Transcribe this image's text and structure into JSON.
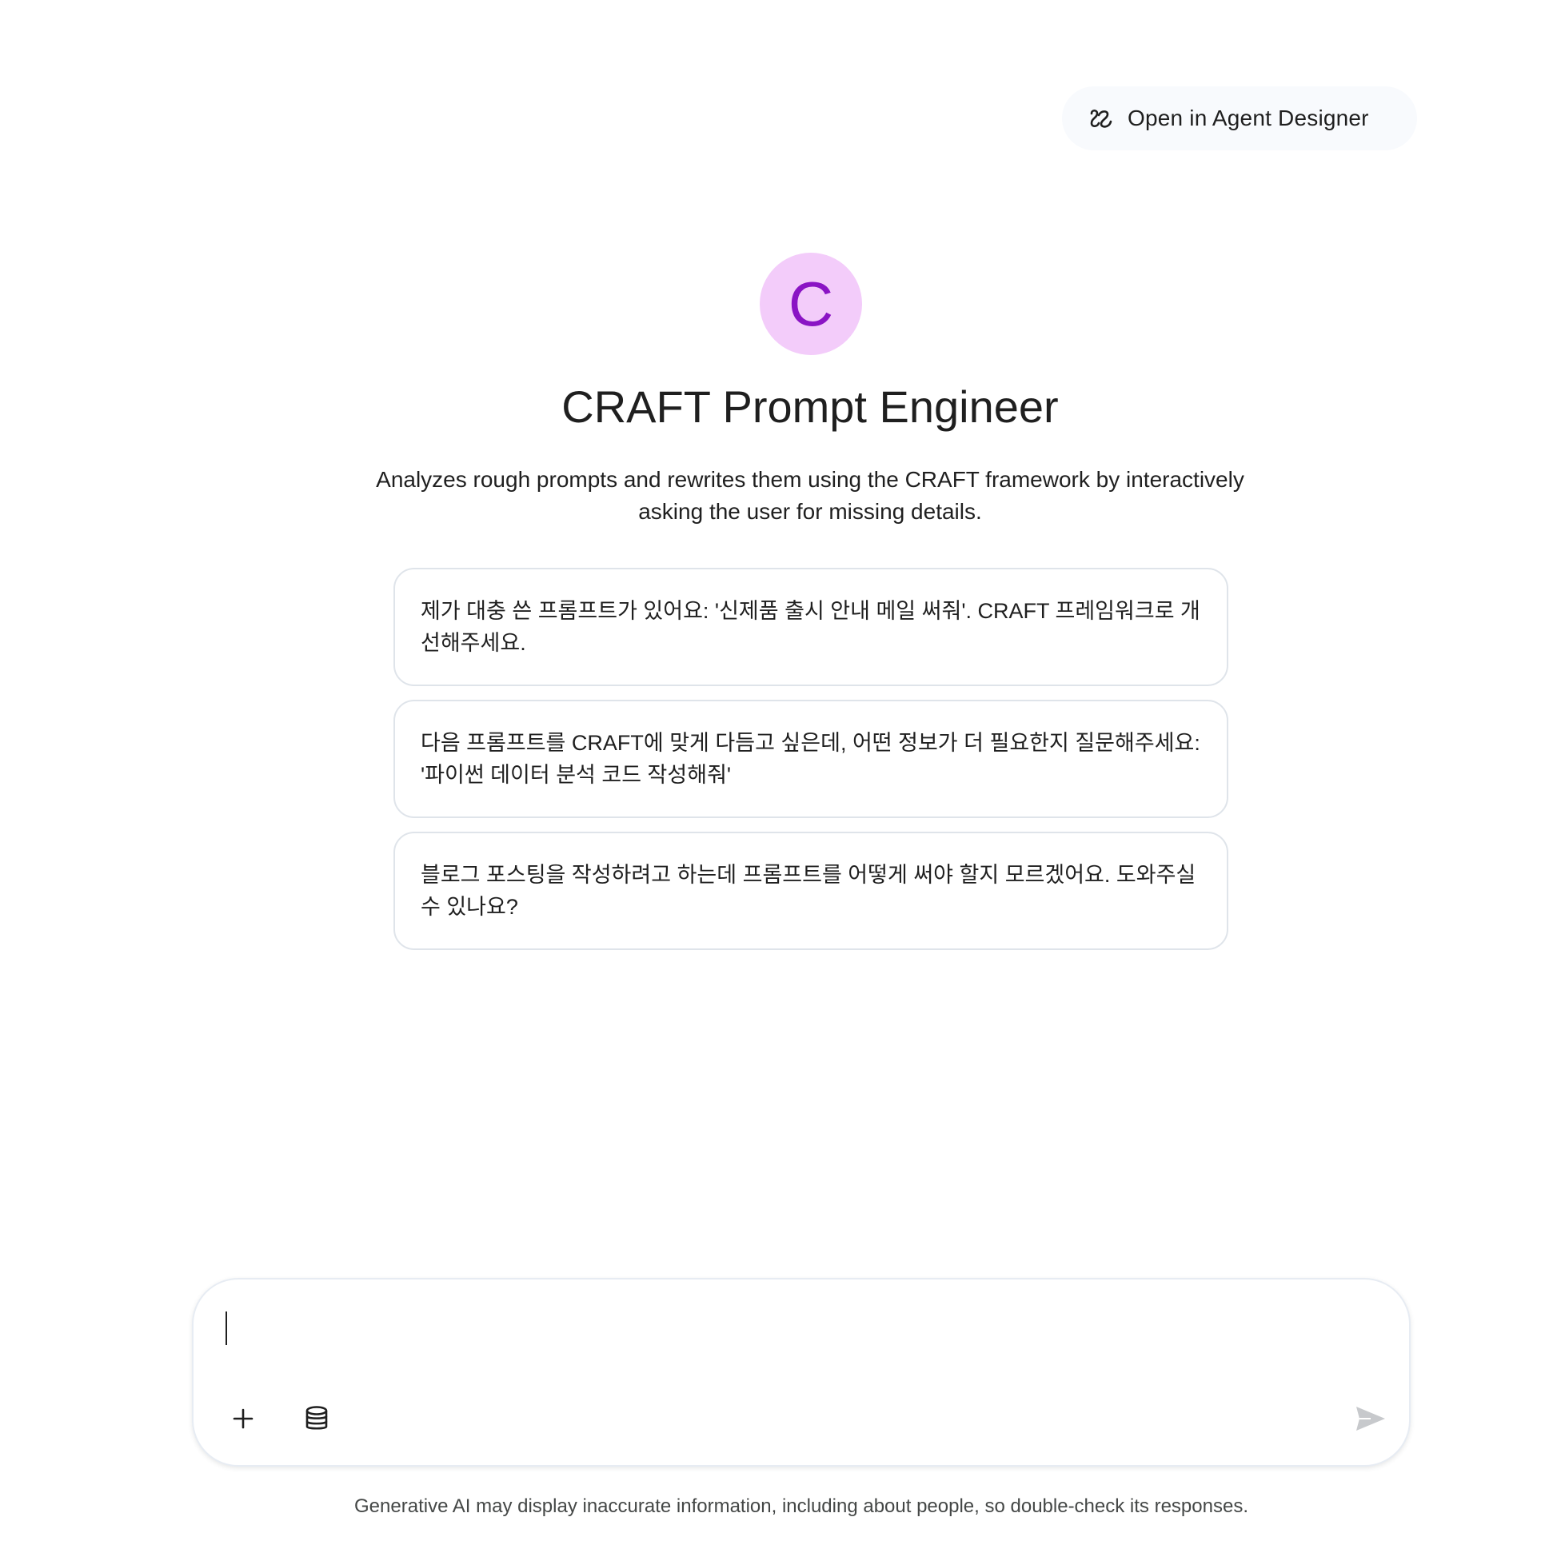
{
  "header": {
    "agent_designer_label": "Open in Agent Designer",
    "agent_designer_icon": "agent-designer-icon"
  },
  "agent": {
    "avatar_letter": "C",
    "avatar_bg_color": "#f3ccfa",
    "avatar_text_color": "#8a14c4",
    "title": "CRAFT Prompt Engineer",
    "description": "Analyzes rough prompts and rewrites them using the CRAFT framework by interactively asking the user for missing details."
  },
  "suggestions": [
    {
      "text": "제가 대충 쓴 프롬프트가 있어요: '신제품 출시 안내 메일 써줘'. CRAFT 프레임워크로 개선해주세요."
    },
    {
      "text": "다음 프롬프트를 CRAFT에 맞게 다듬고 싶은데, 어떤 정보가 더 필요한지 질문해주세요: '파이썬 데이터 분석 코드 작성해줘'"
    },
    {
      "text": "블로그 포스팅을 작성하려고 하는데 프롬프트를 어떻게 써야 할지 모르겠어요. 도와주실 수 있나요?"
    }
  ],
  "composer": {
    "input_value": "",
    "add_icon": "plus-icon",
    "datastore_icon": "database-icon",
    "send_icon": "send-icon"
  },
  "footer": {
    "disclaimer": "Generative AI may display inaccurate information, including about people, so double-check its responses."
  }
}
